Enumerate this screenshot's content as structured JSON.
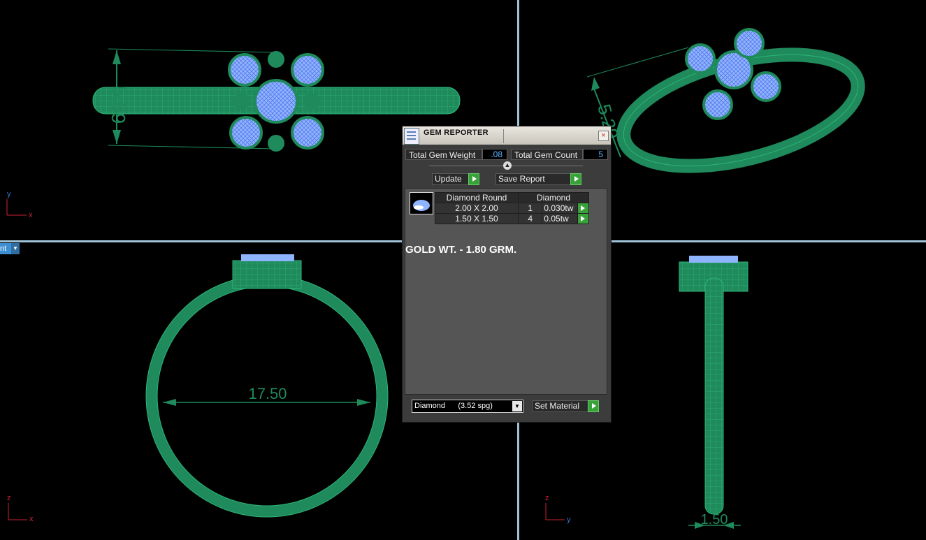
{
  "viewport_tab": {
    "label": "nt"
  },
  "dimensions": {
    "top_left": "5.69",
    "top_right": "5.29",
    "bottom_left": "17.50",
    "bottom_right": "1.50"
  },
  "axes": {
    "top_left": {
      "vertical": "y",
      "horizontal": "x"
    },
    "bottom_left": {
      "vertical": "z",
      "horizontal": "x"
    },
    "bottom_right": {
      "vertical": "z",
      "horizontal": "y"
    }
  },
  "panel": {
    "title": "GEM REPORTER",
    "total_weight_label": "Total Gem Weight",
    "total_weight_value": ".08",
    "total_count_label": "Total Gem Count",
    "total_count_value": "5",
    "update_label": "Update",
    "save_label": "Save Report",
    "table": {
      "headers": [
        "Diamond Round",
        "Diamond"
      ],
      "rows": [
        {
          "size": "2.00 X 2.00",
          "count": "1",
          "weight": "0.030tw"
        },
        {
          "size": "1.50 X 1.50",
          "count": "4",
          "weight": "0.05tw"
        }
      ]
    },
    "note": "GOLD WT. - 1.80 GRM.",
    "material_selected": "Diamond      (3.52 spg)",
    "set_material_label": "Set Material"
  },
  "colors": {
    "ring": "#1f8a5b",
    "gem": "#8fb4ff",
    "divider": "#9fc3d9"
  }
}
